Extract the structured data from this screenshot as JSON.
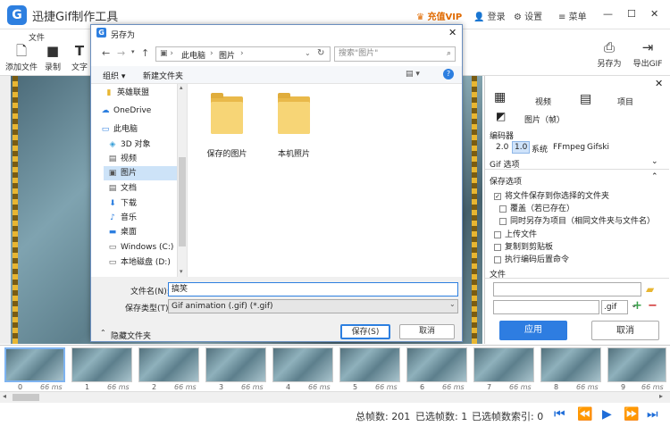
{
  "app": {
    "title": "迅捷Gif制作工具",
    "logo_letter": "G",
    "vip": "充值VIP",
    "login": "登录",
    "settings": "设置",
    "menu": "菜单",
    "minimize": "—",
    "restore": "☐",
    "close": "✕"
  },
  "ribbon": {
    "tab_file": "文件",
    "add_file": "添加文件",
    "record": "录制",
    "text": "文字",
    "save_as": "另存为",
    "export_gif": "导出GIF"
  },
  "right_panel": {
    "close": "✕",
    "video": "视频",
    "project": "项目",
    "images_frames": "图片（帧）",
    "encoder_label": "编码器",
    "encoders": [
      "2.0",
      "1.0",
      "系统",
      "FFmpeg",
      "Gifski"
    ],
    "selected_encoder": "1.0",
    "gif_options": "Gif 选项",
    "save_options": "保存选项",
    "opt_save_to_folder": "将文件保存到你选择的文件夹",
    "opt_overwrite": "覆盖（若已存在）",
    "opt_save_project": "同时另存为项目（相同文件夹与文件名）",
    "opt_upload": "上传文件",
    "opt_clipboard": "复制到剪贴板",
    "opt_post_command": "执行编码后置命令",
    "file_label": "文件",
    "ext": ".gif",
    "apply": "应用",
    "cancel": "取消"
  },
  "dialog": {
    "title": "另存为",
    "back": "←",
    "forward": "→",
    "up": "↑",
    "breadcrumb": [
      "此电脑",
      "图片"
    ],
    "refresh": "↻",
    "search_placeholder": "搜索\"图片\"",
    "organize": "组织 ▾",
    "new_folder": "新建文件夹",
    "view": "▤ ▾",
    "help": "?",
    "nav": [
      {
        "label": "英雄联盟",
        "icon": "folder"
      },
      {
        "label": "OneDrive",
        "icon": "cloud"
      },
      {
        "label": "此电脑",
        "icon": "pc"
      },
      {
        "label": "3D 对象",
        "icon": "cube"
      },
      {
        "label": "视频",
        "icon": "video"
      },
      {
        "label": "图片",
        "icon": "pictures"
      },
      {
        "label": "文档",
        "icon": "document"
      },
      {
        "label": "下载",
        "icon": "download"
      },
      {
        "label": "音乐",
        "icon": "music"
      },
      {
        "label": "桌面",
        "icon": "desktop"
      },
      {
        "label": "Windows (C:)",
        "icon": "drive"
      },
      {
        "label": "本地磁盘 (D:)",
        "icon": "drive"
      }
    ],
    "folders": [
      "保存的图片",
      "本机照片"
    ],
    "filename_label": "文件名(N):",
    "filename_value": "搞笑",
    "filetype_label": "保存类型(T):",
    "filetype_value": "Gif animation (.gif) (*.gif)",
    "hide_folders": "隐藏文件夹",
    "save": "保存(S)",
    "cancel": "取消"
  },
  "filmstrip": {
    "frames": [
      {
        "num": "0",
        "ms": "66 ms"
      },
      {
        "num": "1",
        "ms": "66 ms"
      },
      {
        "num": "2",
        "ms": "66 ms"
      },
      {
        "num": "3",
        "ms": "66 ms"
      },
      {
        "num": "4",
        "ms": "66 ms"
      },
      {
        "num": "5",
        "ms": "66 ms"
      },
      {
        "num": "6",
        "ms": "66 ms"
      },
      {
        "num": "7",
        "ms": "66 ms"
      },
      {
        "num": "8",
        "ms": "66 ms"
      },
      {
        "num": "9",
        "ms": "66 ms"
      }
    ]
  },
  "status": {
    "total_frames": "总帧数: 201",
    "selected_frames": "已选帧数: 1",
    "selected_index": "已选帧数索引: 0"
  },
  "colors": {
    "accent": "#2e7de1",
    "vip": "#e06a00",
    "folder": "#f7d576"
  }
}
